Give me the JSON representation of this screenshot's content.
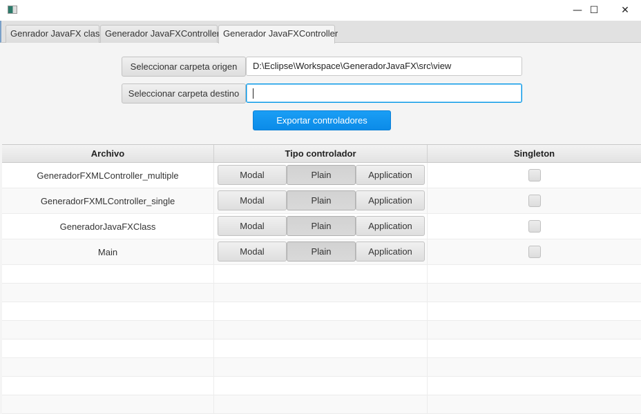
{
  "window": {
    "minimize_icon": "minimize-icon",
    "maximize_icon": "maximize-icon",
    "close_icon": "close-icon",
    "minimize": "—",
    "maximize": "☐",
    "close": "✕"
  },
  "tabs": [
    {
      "label": "Genrador JavaFX class"
    },
    {
      "label": "Generador JavaFXController"
    },
    {
      "label": "Generador JavaFXController",
      "selected": true
    }
  ],
  "form": {
    "origin_button": "Seleccionar carpeta origen",
    "origin_value": "D:\\Eclipse\\Workspace\\GeneradorJavaFX\\src\\view",
    "dest_button": "Seleccionar carpeta destino",
    "dest_value": "",
    "export_button": "Exportar controladores",
    "accent": "#0f93ec"
  },
  "table": {
    "columns": [
      "Archivo",
      "Tipo controlador",
      "Singleton"
    ],
    "segments": [
      "Modal",
      "Plain",
      "Application"
    ],
    "rows": [
      {
        "file": "GeneradorFXMLController_multiple",
        "type": "Plain",
        "singleton": false
      },
      {
        "file": "GeneradorFXMLController_single",
        "type": "Plain",
        "singleton": false
      },
      {
        "file": "GeneradorJavaFXClass",
        "type": "Plain",
        "singleton": false
      },
      {
        "file": "Main",
        "type": "Plain",
        "singleton": false
      }
    ]
  }
}
